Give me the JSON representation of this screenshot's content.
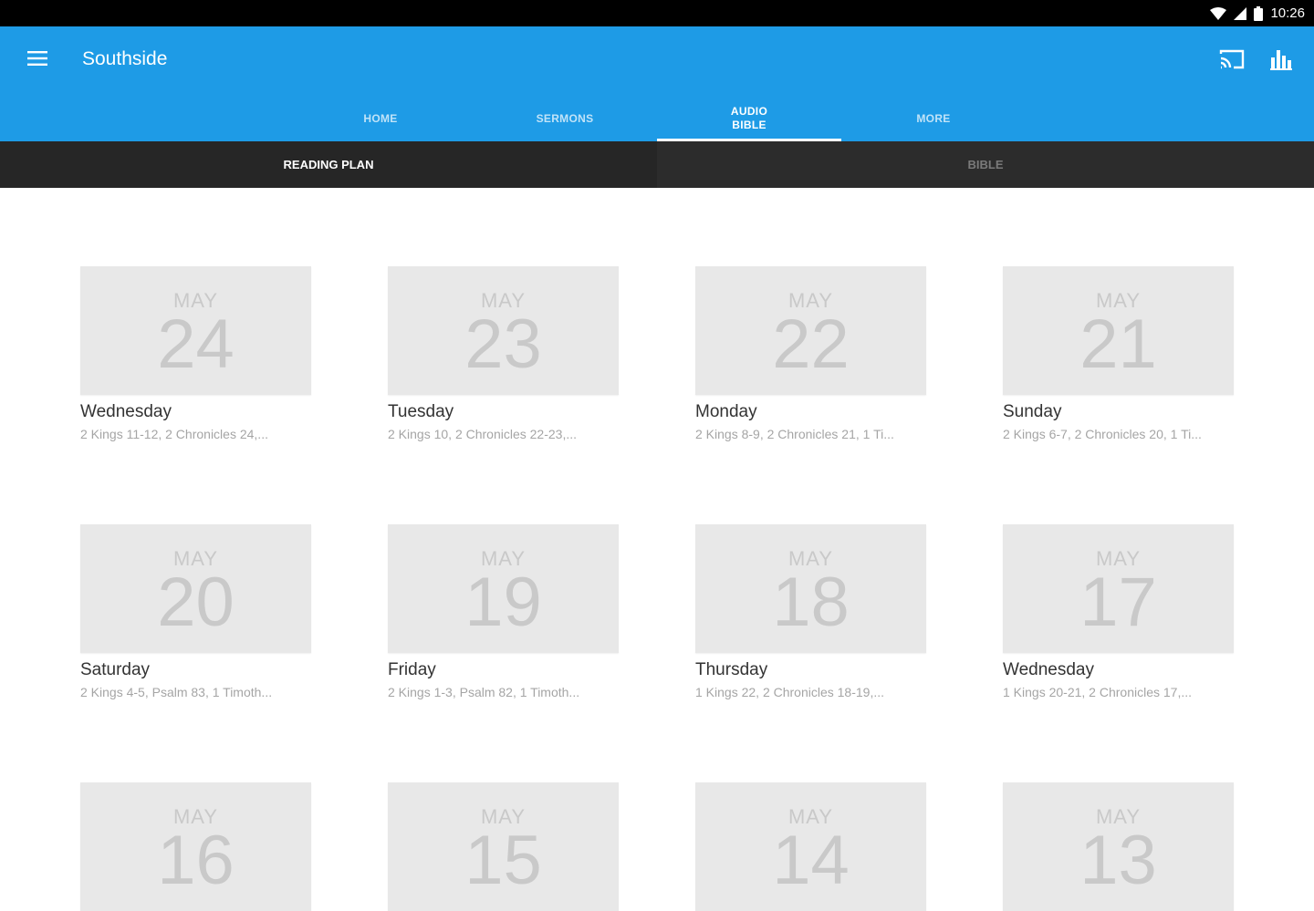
{
  "status_bar": {
    "time": "10:26"
  },
  "app_bar": {
    "title": "Southside",
    "tabs": [
      {
        "label": "HOME",
        "active": false
      },
      {
        "label": "SERMONS",
        "active": false
      },
      {
        "label": "AUDIO BIBLE",
        "active": true
      },
      {
        "label": "MORE",
        "active": false
      }
    ]
  },
  "subtabs": [
    {
      "label": "READING PLAN",
      "active": true
    },
    {
      "label": "BIBLE",
      "active": false
    }
  ],
  "cards": [
    {
      "month": "MAY",
      "day": "24",
      "weekday": "Wednesday",
      "reading": "2 Kings 11-12, 2 Chronicles 24,..."
    },
    {
      "month": "MAY",
      "day": "23",
      "weekday": "Tuesday",
      "reading": "2 Kings 10, 2 Chronicles 22-23,..."
    },
    {
      "month": "MAY",
      "day": "22",
      "weekday": "Monday",
      "reading": "2 Kings 8-9, 2 Chronicles 21, 1 Ti..."
    },
    {
      "month": "MAY",
      "day": "21",
      "weekday": "Sunday",
      "reading": "2 Kings 6-7, 2 Chronicles 20, 1 Ti..."
    },
    {
      "month": "MAY",
      "day": "20",
      "weekday": "Saturday",
      "reading": "2 Kings 4-5, Psalm 83, 1 Timoth..."
    },
    {
      "month": "MAY",
      "day": "19",
      "weekday": "Friday",
      "reading": "2 Kings 1-3, Psalm 82, 1 Timoth..."
    },
    {
      "month": "MAY",
      "day": "18",
      "weekday": "Thursday",
      "reading": "1 Kings 22, 2 Chronicles 18-19,..."
    },
    {
      "month": "MAY",
      "day": "17",
      "weekday": "Wednesday",
      "reading": "1 Kings 20-21, 2 Chronicles 17,..."
    },
    {
      "month": "MAY",
      "day": "16",
      "weekday": "",
      "reading": ""
    },
    {
      "month": "MAY",
      "day": "15",
      "weekday": "",
      "reading": ""
    },
    {
      "month": "MAY",
      "day": "14",
      "weekday": "",
      "reading": ""
    },
    {
      "month": "MAY",
      "day": "13",
      "weekday": "",
      "reading": ""
    }
  ],
  "icons": {
    "menu": "hamburger-menu-icon",
    "cast": "cast-icon",
    "stats": "bar-chart-icon",
    "wifi": "wifi-icon",
    "signal": "cellular-signal-icon",
    "battery": "battery-icon"
  }
}
